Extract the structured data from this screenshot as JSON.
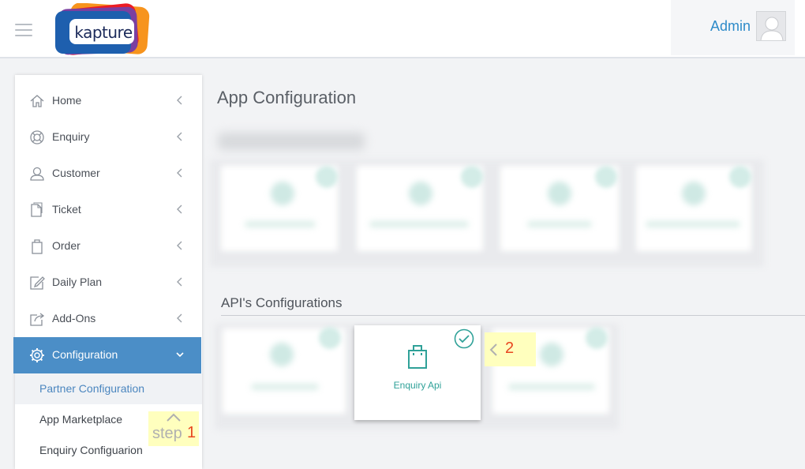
{
  "header": {
    "logo_text": "kapture",
    "user_name": "Admin"
  },
  "sidebar": {
    "items": [
      {
        "label": "Home",
        "icon": "home-icon"
      },
      {
        "label": "Enquiry",
        "icon": "lifebuoy-icon"
      },
      {
        "label": "Customer",
        "icon": "user-icon"
      },
      {
        "label": "Ticket",
        "icon": "ticket-icon"
      },
      {
        "label": "Order",
        "icon": "bag-icon"
      },
      {
        "label": "Daily Plan",
        "icon": "edit-icon"
      },
      {
        "label": "Add-Ons",
        "icon": "share-icon"
      },
      {
        "label": "Configuration",
        "icon": "gear-icon",
        "active": true
      }
    ],
    "sub_items": [
      {
        "label": "Partner Configuration",
        "selected": true
      },
      {
        "label": "App Marketplace"
      },
      {
        "label": "Enquiry Configuarion"
      }
    ]
  },
  "annotations": {
    "step1_word": "step",
    "step1_number": "1",
    "step2_number": "2"
  },
  "main": {
    "title": "App Configuration",
    "api_section_title": "API's Configurations",
    "api_card_label": "Enquiry Api",
    "api_card_selected": true
  },
  "colors": {
    "accent": "#4b8ec7",
    "teal": "#2fa198",
    "highlight": "#ffffbe",
    "annotation_number": "#e8461f"
  }
}
